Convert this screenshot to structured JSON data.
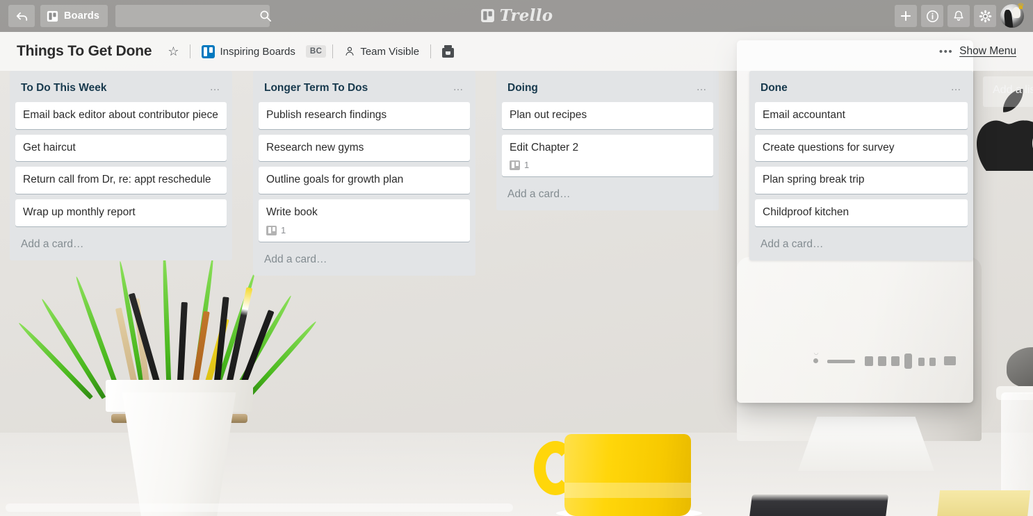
{
  "top_nav": {
    "back_icon": "back-arrow-icon",
    "boards_label": "Boards",
    "boards_icon": "board-icon",
    "search_value": "",
    "search_placeholder": "",
    "search_icon": "search-icon",
    "logo_text": "Trello",
    "logo_icon": "trello-board-icon",
    "add_icon": "plus-icon",
    "info_icon": "info-icon",
    "notifications_icon": "bell-icon",
    "settings_icon": "gear-icon",
    "avatar_icon": "user-avatar",
    "avatar_badge_icon": "gold-crown-icon",
    "background_color": "rgba(0,0,0,0.33)"
  },
  "board_header": {
    "title": "Things To Get Done",
    "star_icon": "star-outline-icon",
    "team_name": "Inspiring Boards",
    "team_icon": "board-icon",
    "team_badge": "BC",
    "visibility_label": "Team Visible",
    "visibility_icon": "person-icon",
    "butler_icon": "butler-robot-icon",
    "menu_dots": "•••",
    "show_menu_label": "Show Menu",
    "team_icon_color": "#0079bf"
  },
  "lists": [
    {
      "id": "to-do-this-week",
      "title": "To Do This Week",
      "menu_icon": "list-menu-icon",
      "add_card_label": "Add a card…",
      "cards": [
        {
          "title": "Email back editor about contributor piece"
        },
        {
          "title": "Get haircut"
        },
        {
          "title": "Return call from Dr, re: appt reschedule"
        },
        {
          "title": "Wrap up monthly report"
        }
      ]
    },
    {
      "id": "longer-term-to-dos",
      "title": "Longer Term To Dos",
      "menu_icon": "list-menu-icon",
      "add_card_label": "Add a card…",
      "cards": [
        {
          "title": "Publish research findings"
        },
        {
          "title": "Research new gyms"
        },
        {
          "title": "Outline goals for growth plan"
        },
        {
          "title": "Write book",
          "badge_icon": "board-badge-icon",
          "badge_count": "1"
        }
      ]
    },
    {
      "id": "doing",
      "title": "Doing",
      "menu_icon": "list-menu-icon",
      "add_card_label": "Add a card…",
      "cards": [
        {
          "title": "Plan out recipes"
        },
        {
          "title": "Edit Chapter 2",
          "badge_icon": "board-badge-icon",
          "badge_count": "1"
        }
      ]
    },
    {
      "id": "done",
      "title": "Done",
      "menu_icon": "list-menu-icon",
      "add_card_label": "Add a card…",
      "elevated": true,
      "cards": [
        {
          "title": "Email accountant"
        },
        {
          "title": "Create questions for survey"
        },
        {
          "title": "Plan spring break trip"
        },
        {
          "title": "Childproof kitchen"
        }
      ]
    }
  ],
  "add_list": {
    "label": "Add a list…"
  },
  "scrollbar": {
    "orientation": "horizontal"
  },
  "colors": {
    "list_background": "#e2e4e6",
    "card_background": "#ffffff",
    "list_title": "#17394d",
    "muted_text": "#838c91",
    "accent_blue": "#0079bf",
    "mug_yellow": "#ffd60a"
  }
}
